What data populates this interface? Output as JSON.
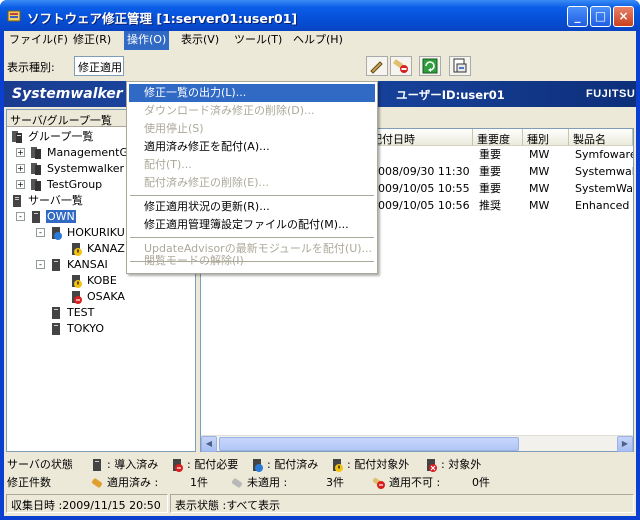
{
  "window": {
    "title": "ソフトウェア修正管理 [1:server01:user01]",
    "minimize": "_",
    "maximize": "□",
    "close": "×"
  },
  "menubar": {
    "items": [
      {
        "label": "ファイル(F)"
      },
      {
        "label": "修正(R)"
      },
      {
        "label": "操作(O)"
      },
      {
        "label": "表示(V)"
      },
      {
        "label": "ツール(T)"
      },
      {
        "label": "ヘルプ(H)"
      }
    ]
  },
  "toolbar": {
    "display_type_label": "表示種別:",
    "display_type_value": "修正適用"
  },
  "banner": {
    "logo": "Systemwalker",
    "user": "ユーザーID:user01",
    "brand": "FUJITSU"
  },
  "left_pane": {
    "header": "サーバ/グループ一覧",
    "tree": {
      "group_list": "グループ一覧",
      "groups": [
        "ManagementGr",
        "Systemwalker",
        "TestGroup"
      ],
      "server_list": "サーバ一覧",
      "own": "OWN",
      "hokuriku": "HOKURIKU",
      "kanaz": "KANAZ",
      "kansai": "KANSAI",
      "kobe": "KOBE",
      "osaka": "OSAKA",
      "test": "TEST",
      "tokyo": "TOKYO"
    }
  },
  "table": {
    "columns": [
      "配付日時",
      "重要度",
      "種別",
      "製品名"
    ],
    "rows": [
      {
        "date": "",
        "importance": "重要",
        "type": "MW",
        "product": "Symfoware"
      },
      {
        "date": "2008/09/30 11:30",
        "importance": "重要",
        "type": "MW",
        "product": "Systemwalk"
      },
      {
        "date": "2009/10/05 10:55",
        "importance": "重要",
        "type": "MW",
        "product": "SystemWalk"
      },
      {
        "date": "2009/10/05 10:56",
        "importance": "推奨",
        "type": "MW",
        "product": "Enhanced S"
      }
    ]
  },
  "operation_menu": {
    "items": [
      {
        "label": "修正一覧の出力(L)...",
        "state": "highlighted"
      },
      {
        "label": "ダウンロード済み修正の削除(D)...",
        "state": "disabled"
      },
      {
        "label": "使用停止(S)",
        "state": "disabled"
      },
      {
        "label": "適用済み修正を配付(A)...",
        "state": "enabled"
      },
      {
        "label": "配付(T)...",
        "state": "disabled"
      },
      {
        "label": "配付済み修正の削除(E)...",
        "state": "disabled"
      },
      {
        "label": "修正適用状況の更新(R)...",
        "state": "enabled"
      },
      {
        "label": "修正適用管理簿設定ファイルの配付(M)...",
        "state": "enabled"
      },
      {
        "label": "UpdateAdvisorの最新モジュールを配付(U)...",
        "state": "disabled"
      },
      {
        "label": "閲覧モードの解除(I)",
        "state": "disabled"
      }
    ]
  },
  "legend": {
    "server_status_label": "サーバの状態",
    "installed": ": 導入済み",
    "distribution_required": ": 配付必要",
    "distributed": ": 配付済み",
    "distribution_target": ": 配付対象外",
    "target": ": 対象外",
    "fix_count_label": "修正件数",
    "applied_label": "適用済み :",
    "applied_count": "1件",
    "unapplied_label": "未適用   :",
    "unapplied_count": "3件",
    "not_applicable_label": "適用不可 :",
    "not_applicable_count": "0件"
  },
  "statusbar": {
    "collected": "収集日時 :2009/11/15 20:50",
    "display_state": "表示状態 :すべて表示"
  },
  "colors": {
    "titlebar": "#0a5ce6",
    "highlight": "#316ac5",
    "window_bg": "#ece9d8"
  }
}
